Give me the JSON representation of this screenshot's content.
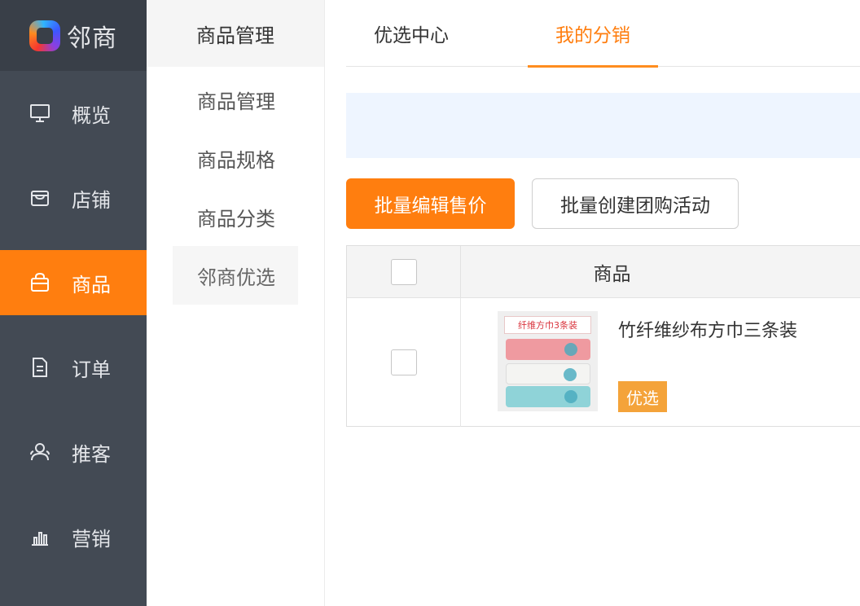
{
  "logo": {
    "icon": "brand-logo-icon",
    "text": "邻商"
  },
  "sidebar": {
    "items": [
      {
        "label": "概览",
        "icon": "monitor-icon"
      },
      {
        "label": "店铺",
        "icon": "store-icon"
      },
      {
        "label": "商品",
        "icon": "bag-icon",
        "active": true
      },
      {
        "label": "订单",
        "icon": "document-icon"
      },
      {
        "label": "推客",
        "icon": "users-icon"
      },
      {
        "label": "营销",
        "icon": "bar-chart-icon"
      }
    ]
  },
  "subnav": {
    "header": "商品管理",
    "items": [
      {
        "label": "商品管理"
      },
      {
        "label": "商品规格"
      },
      {
        "label": "商品分类"
      },
      {
        "label": "邻商优选",
        "active": true
      }
    ]
  },
  "tabs": [
    {
      "label": "优选中心"
    },
    {
      "label": "我的分销",
      "active": true
    }
  ],
  "toolbar": {
    "batch_edit_price": "批量编辑售价",
    "batch_create_group": "批量创建团购活动"
  },
  "table": {
    "header_product": "商品",
    "rows": [
      {
        "thumb_text": "纤维方巾3条装",
        "name": "竹纤维纱布方巾三条装",
        "badge": "优选"
      }
    ]
  },
  "colors": {
    "accent": "#ff7e0f",
    "sidebar_bg": "#434a54",
    "notice_bg": "#eef5ff",
    "badge_bg": "#f4a33a"
  }
}
